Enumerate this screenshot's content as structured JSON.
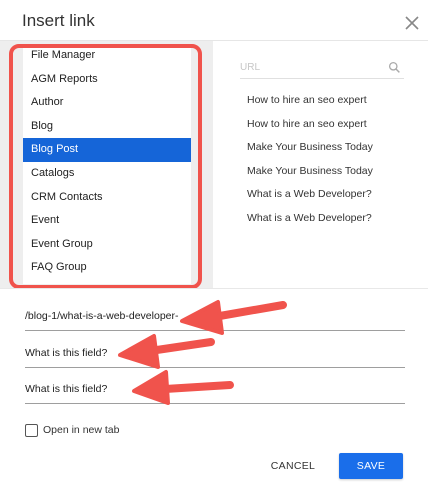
{
  "dialog": {
    "title": "Insert link"
  },
  "type_list": {
    "items": [
      {
        "label": "File Manager"
      },
      {
        "label": "AGM Reports"
      },
      {
        "label": "Author"
      },
      {
        "label": "Blog"
      },
      {
        "label": "Blog Post"
      },
      {
        "label": "Catalogs"
      },
      {
        "label": "CRM Contacts"
      },
      {
        "label": "Event"
      },
      {
        "label": "Event Group"
      },
      {
        "label": "FAQ Group"
      }
    ],
    "selected_label": "Blog Post"
  },
  "url_search": {
    "placeholder": "URL",
    "icon": "search-icon"
  },
  "url_results": [
    {
      "label": "How to hire an seo expert"
    },
    {
      "label": "How to hire an seo expert"
    },
    {
      "label": "Make Your Business Today"
    },
    {
      "label": "Make Your Business Today"
    },
    {
      "label": "What is a Web Developer?"
    },
    {
      "label": "What is a Web Developer?"
    }
  ],
  "fields": {
    "url_value": "/blog-1/what-is-a-web-developer-",
    "field2_text": "What is this field?",
    "field3_text": "What is this field?"
  },
  "options": {
    "open_new_tab_label": "Open in new tab",
    "open_new_tab_checked": false
  },
  "actions": {
    "cancel_label": "CANCEL",
    "save_label": "SAVE"
  },
  "colors": {
    "accent": "#1a6eea",
    "selected_item": "#1565d8",
    "annotation": "#f0534c",
    "panel_bg": "#eeeeee"
  }
}
